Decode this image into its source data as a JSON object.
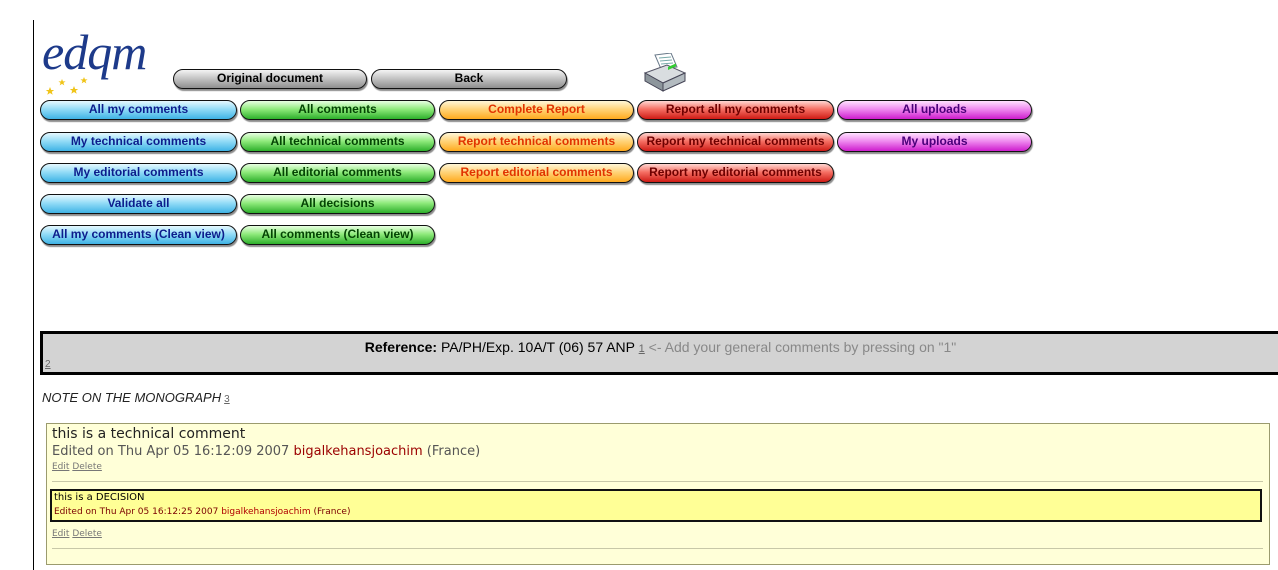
{
  "logo": {
    "text": "edqm"
  },
  "top_buttons": {
    "original_document": "Original document",
    "back": "Back"
  },
  "buttons": {
    "row1": [
      "All my comments",
      "All comments",
      "Complete Report",
      "Report all my comments",
      "All uploads"
    ],
    "row2": [
      "My technical comments",
      "All technical comments",
      "Report technical comments",
      "Report my technical comments",
      "My uploads"
    ],
    "row3": [
      "My editorial comments",
      "All editorial comments",
      "Report editorial comments",
      "Report my editorial comments"
    ],
    "row4": [
      "Validate all",
      "All decisions"
    ],
    "row5": [
      "All my comments (Clean view)",
      "All comments (Clean view)"
    ]
  },
  "reference": {
    "label": "Reference:",
    "value": "PA/PH/Exp. 10A/T (06) 57 ANP",
    "link": "1",
    "hint": "<- Add your general comments by pressing on \"1\"",
    "left_link": "2"
  },
  "note": {
    "title": "NOTE ON THE MONOGRAPH",
    "link": "3"
  },
  "comment": {
    "text": "this is a technical comment",
    "edited_prefix": "Edited on Thu Apr 05 16:12:09 2007",
    "author": "bigalkehansjoachim",
    "country": "(France)",
    "edit": "Edit",
    "delete": "Delete"
  },
  "decision": {
    "text": "this is a DECISION",
    "edited_prefix": "Edited on Thu Apr 05 16:12:25 2007",
    "author": "bigalkehansjoachim",
    "country": "(France)",
    "edit": "Edit",
    "delete": "Delete"
  },
  "colors": {
    "blue": "#93dcf7",
    "green": "#8fea7c",
    "orange": "#ffd47a",
    "red": "#f57064",
    "purple": "#ef8bef",
    "gray": "#c6c6c6",
    "comment_bg": "#ffffd8",
    "decision_bg": "#ffff96",
    "author": "#9b0000"
  }
}
